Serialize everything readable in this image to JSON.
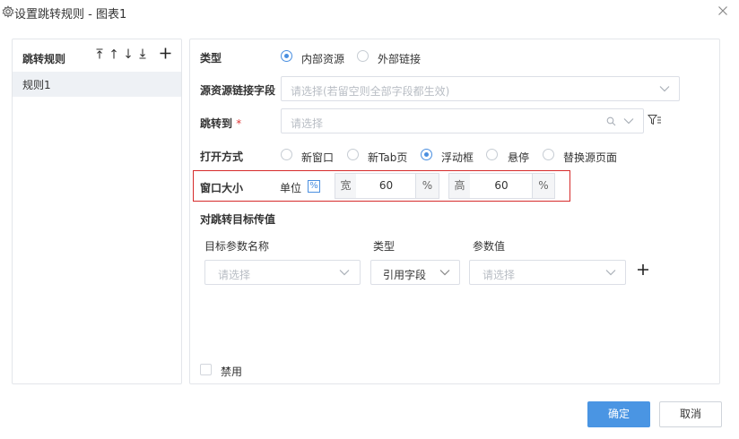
{
  "dialog": {
    "title": "设置跳转规则 - 图表1"
  },
  "left": {
    "header": "跳转规则",
    "rules": [
      "规则1"
    ]
  },
  "form": {
    "type": {
      "label": "类型",
      "options": [
        "内部资源",
        "外部链接"
      ],
      "selected": "内部资源"
    },
    "source_field": {
      "label": "源资源链接字段",
      "placeholder": "请选择(若留空则全部字段都生效)"
    },
    "jump_to": {
      "label": "跳转到",
      "required_mark": "*",
      "placeholder": "请选择"
    },
    "open_mode": {
      "label": "打开方式",
      "options": [
        "新窗口",
        "新Tab页",
        "浮动框",
        "悬停",
        "替换源页面"
      ],
      "selected": "浮动框"
    },
    "window_size": {
      "label": "窗口大小",
      "unit_label": "单位",
      "unit_icon": "%",
      "width_label": "宽",
      "width_value": "60",
      "width_unit": "%",
      "height_label": "高",
      "height_value": "60",
      "height_unit": "%"
    },
    "params": {
      "label": "对跳转目标传值",
      "col_name": "目标参数名称",
      "col_type": "类型",
      "col_value": "参数值",
      "row": {
        "name_placeholder": "请选择",
        "type_value": "引用字段",
        "value_placeholder": "请选择"
      }
    },
    "disable_label": "禁用"
  },
  "footer": {
    "ok_label": "确定",
    "cancel_label": "取消"
  },
  "colors": {
    "accent": "#4a95e3",
    "highlight_border": "#d62b2b",
    "required": "#e03a3a"
  }
}
